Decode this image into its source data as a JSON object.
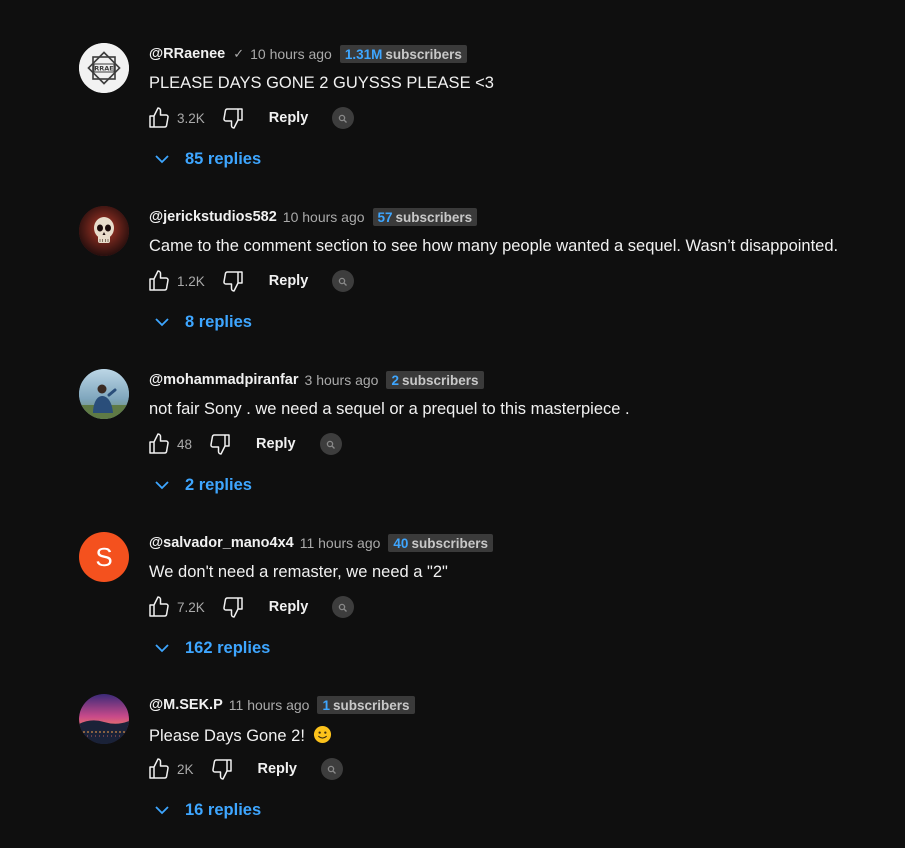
{
  "reply_label": "Reply",
  "colors": {
    "background": "#0f0f0f",
    "accent_blue": "#3ea6ff",
    "muted_text": "#aaaaaa",
    "badge_bg": "#3a3a3a",
    "avatar_orange": "#f4511e"
  },
  "comments": [
    {
      "handle": "@RRaenee",
      "verified_mark": "✓",
      "time": "10 hours ago",
      "subscriber_count": "1.31M",
      "subscriber_label": "subscribers",
      "text": "PLEASE DAYS GONE 2 GUYSSS PLEASE <3",
      "likes": "3.2K",
      "replies": "85 replies"
    },
    {
      "handle": "@jerickstudios582",
      "time": "10 hours ago",
      "subscriber_count": "57",
      "subscriber_label": "subscribers",
      "text": "Came to the comment section to see how many people wanted a sequel. Wasn’t disappointed.",
      "likes": "1.2K",
      "replies": "8 replies"
    },
    {
      "handle": "@mohammadpiranfar",
      "time": "3 hours ago",
      "subscriber_count": "2",
      "subscriber_label": "subscribers",
      "text": "not fair Sony . we need a sequel or a prequel to this masterpiece .",
      "likes": "48",
      "replies": "2 replies"
    },
    {
      "handle": "@salvador_mano4x4",
      "avatar_letter": "S",
      "time": "11 hours ago",
      "subscriber_count": "40",
      "subscriber_label": "subscribers",
      "text": "We don't need a remaster, we need a \"2\"",
      "likes": "7.2K",
      "replies": "162 replies"
    },
    {
      "handle": "@M.SEK.P",
      "time": "11 hours ago",
      "subscriber_count": "1",
      "subscriber_label": "subscribers",
      "text": "Please Days Gone 2!",
      "emoji": "slightly-smiling-face-emoji",
      "likes": "2K",
      "replies": "16 replies"
    }
  ],
  "icons": {
    "like": "thumbs-up-icon",
    "dislike": "thumbs-down-icon",
    "expand": "chevron-down-icon",
    "extension": "extension-icon",
    "verified": "checkmark-icon"
  }
}
